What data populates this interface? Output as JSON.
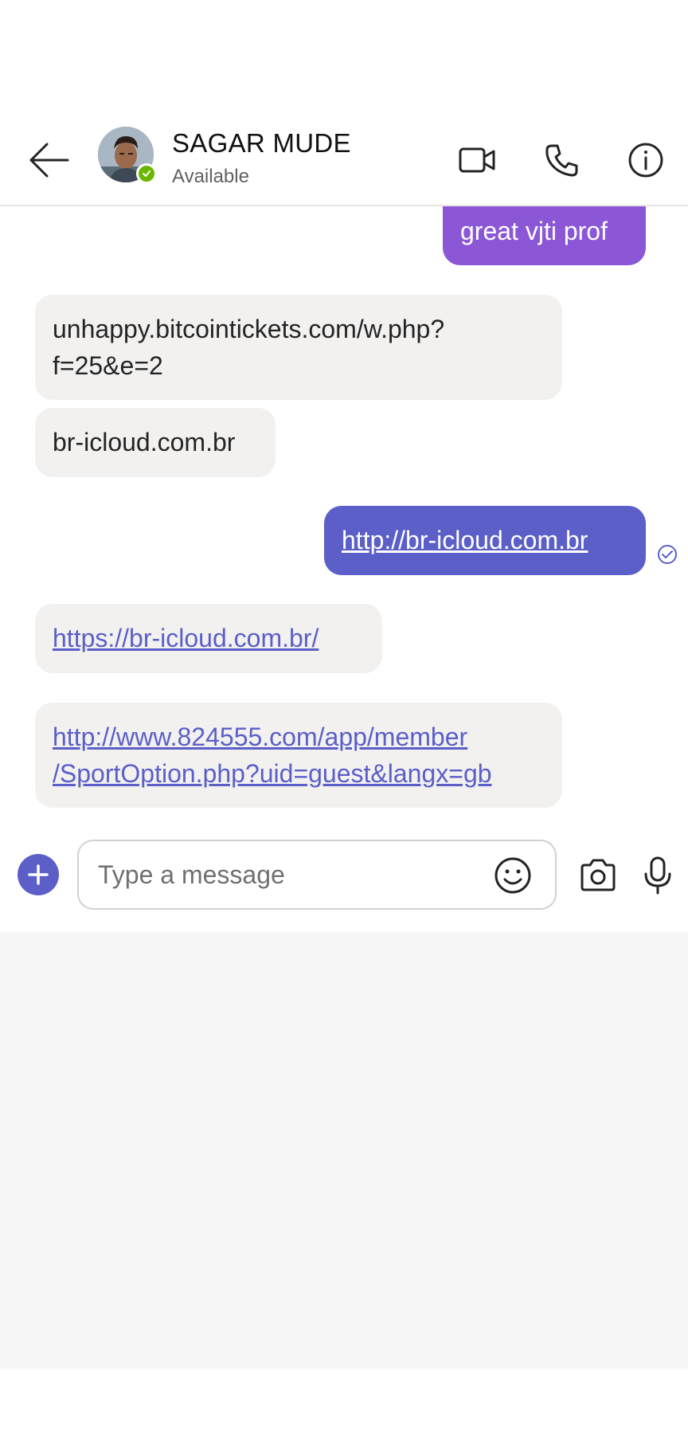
{
  "header": {
    "contact_name": "SAGAR MUDE",
    "contact_status": "Available",
    "presence_color": "#6bb700",
    "icons": [
      "back-arrow-icon",
      "video-call-icon",
      "phone-call-icon",
      "info-icon"
    ]
  },
  "messages": [
    {
      "direction": "outgoing",
      "text": "great vjti prof",
      "is_link": false
    },
    {
      "direction": "incoming",
      "text": "unhappy.bitcointickets.com/w.php?\nf=25&e=2",
      "is_link": false
    },
    {
      "direction": "incoming",
      "text": "br-icloud.com.br",
      "is_link": false
    },
    {
      "direction": "outgoing",
      "text": "http://br-icloud.com.br",
      "is_link": true
    },
    {
      "direction": "incoming",
      "text": "https://br-icloud.com.br/",
      "is_link": true
    },
    {
      "direction": "incoming",
      "text": "http://www.824555.com/app/member\n/SportOption.php?uid=guest&langx=gb",
      "is_link": true
    }
  ],
  "compose": {
    "placeholder": "Type a message",
    "value": ""
  },
  "colors": {
    "accent": "#5b5fc7",
    "outgoing_purple": "#8b57d6",
    "incoming_bubble": "#f2f1f0",
    "keyboard_area": "#f7f7f7"
  }
}
